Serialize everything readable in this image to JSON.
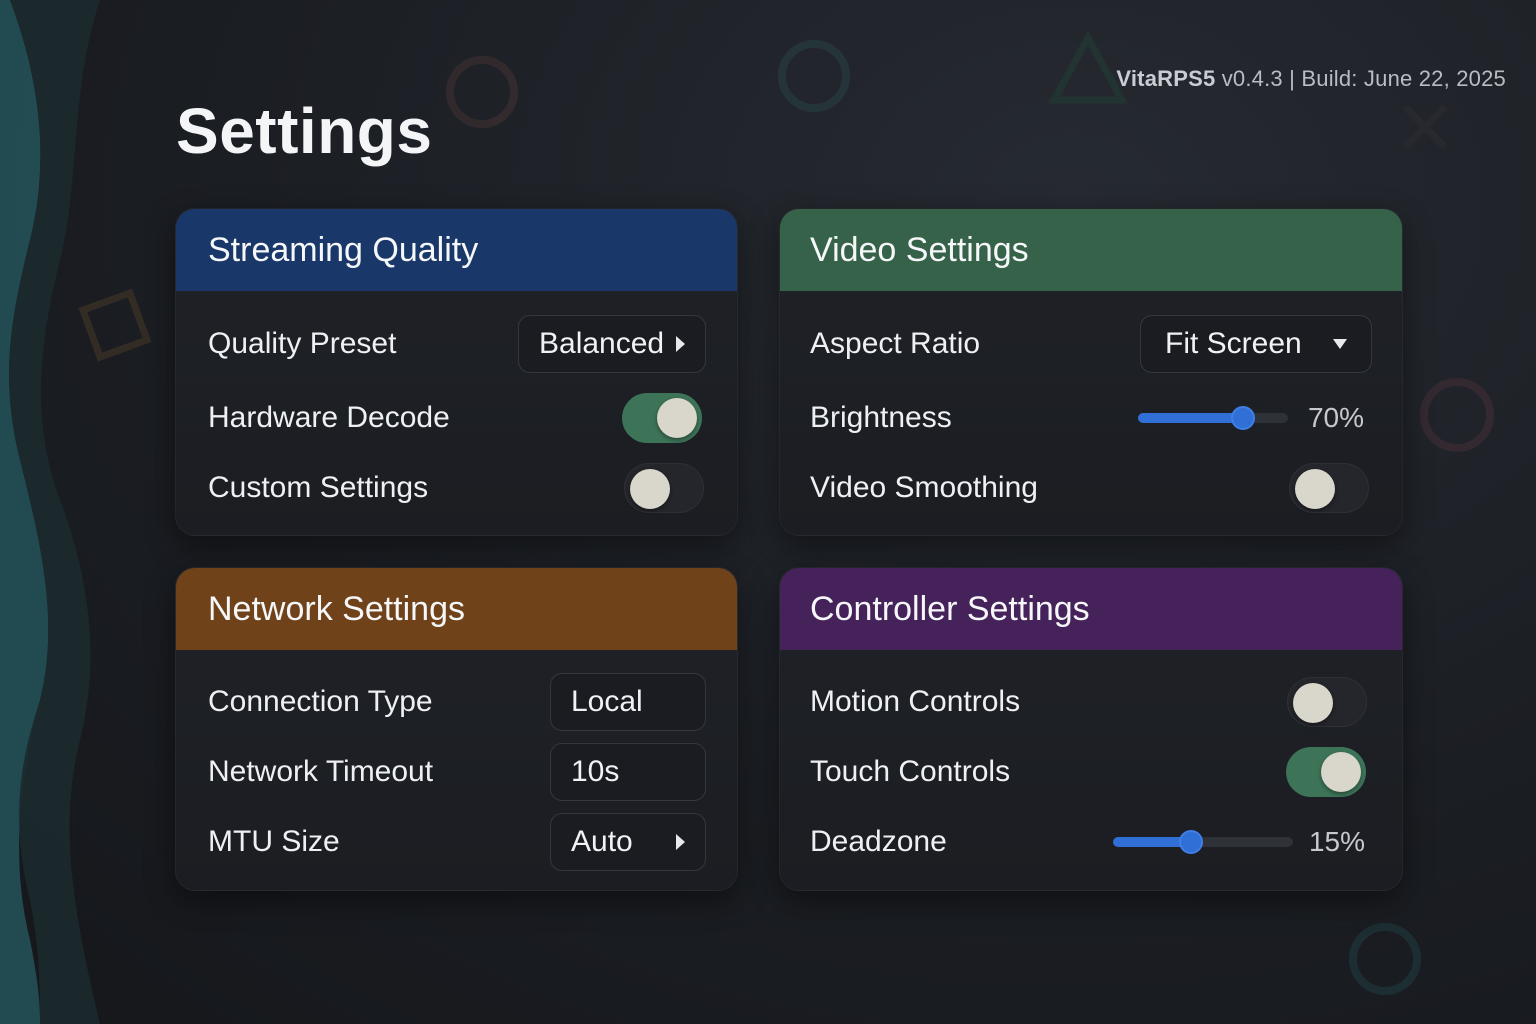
{
  "header": {
    "app_name": "VitaRPS5",
    "version_info": "v0.4.3 | Build: June 22, 2025",
    "title": "Settings"
  },
  "colors": {
    "streaming_header": "#193869",
    "video_header": "#356249",
    "network_header": "#6f4219",
    "controller_header": "#46225a",
    "toggle_on": "#3d7458",
    "slider_accent": "#2f6fd6"
  },
  "streaming": {
    "title": "Streaming Quality",
    "quality_preset": {
      "label": "Quality Preset",
      "value": "Balanced"
    },
    "hardware_decode": {
      "label": "Hardware Decode",
      "on": true
    },
    "custom_settings": {
      "label": "Custom Settings",
      "on": false
    }
  },
  "video": {
    "title": "Video Settings",
    "aspect_ratio": {
      "label": "Aspect Ratio",
      "value": "Fit Screen"
    },
    "brightness": {
      "label": "Brightness",
      "value": 70,
      "display": "70%"
    },
    "video_smoothing": {
      "label": "Video Smoothing",
      "on": false
    }
  },
  "network": {
    "title": "Network Settings",
    "connection_type": {
      "label": "Connection Type",
      "value": "Local"
    },
    "network_timeout": {
      "label": "Network Timeout",
      "value": "10s"
    },
    "mtu_size": {
      "label": "MTU Size",
      "value": "Auto"
    }
  },
  "controller": {
    "title": "Controller Settings",
    "motion_controls": {
      "label": "Motion Controls",
      "on": false
    },
    "touch_controls": {
      "label": "Touch Controls",
      "on": true
    },
    "deadzone": {
      "label": "Deadzone",
      "value": 15,
      "display": "15%"
    }
  }
}
